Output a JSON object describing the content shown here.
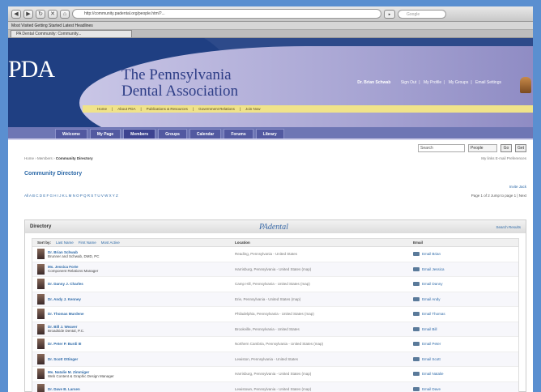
{
  "browser": {
    "url": "http://community.padental.org/people.html?...",
    "search_placeholder": "Google",
    "bookmarks": "Most Visited   Getting Started   Latest Headlines",
    "tab_title": "PA Dental Community: Community..."
  },
  "header": {
    "logo": "PDA",
    "title_line1": "The Pennsylvania",
    "title_line2": "Dental Association",
    "user_name": "Dr. Brian Schwab",
    "links": [
      "Sign Out",
      "My Profile",
      "My Groups",
      "Email Settings"
    ],
    "sub_nav": [
      "Home",
      "About PDA",
      "Publications & Resources",
      "Government Relations",
      "Join Now"
    ]
  },
  "main_nav": [
    "Welcome",
    "My Page",
    "Members",
    "Groups",
    "Calendar",
    "Forums",
    "Library"
  ],
  "search": {
    "value": "Search",
    "scope": "People",
    "go_label": "Go",
    "go2_label": "Get"
  },
  "breadcrumb": {
    "home": "Home",
    "sep1": "›",
    "members": "Members",
    "sep2": "›",
    "current": "Community Directory",
    "right_info": "My links   E-mail Preferences"
  },
  "page_title": "Community Directory",
  "invite_link": "Invite Jack",
  "alphabet": "All  A  B  C  D  E  F  G  H  I  J  K  L  M  N  O  P  Q  R  S  T  U  V  W  X  Y  Z",
  "pagination": "Page 1 of 2   Jump to page 1   |  Next",
  "directory": {
    "title": "Directory",
    "mark": "PAdental",
    "search_results": "Search Results",
    "sort_by_label": "Sort by:",
    "sort_options": [
      "Last Name",
      "First Name",
      "Most Active"
    ],
    "col_location": "Location",
    "col_email": "Email",
    "rows": [
      {
        "name": "Dr. Brian Schwab",
        "sub": "Brunner and Schwab, DMD, PC",
        "location": "Reading, Pennsylvania - United States",
        "email": "Email Brian"
      },
      {
        "name": "Ms. Jessica Forte",
        "sub": "Component Relations Manager",
        "location": "Harrisburg, Pennsylvania - United States (map)",
        "email": "Email Jessica"
      },
      {
        "name": "Dr. Danny J. Charles",
        "sub": "",
        "location": "Camp Hill, Pennsylvania - United States (map)",
        "email": "Email Danny"
      },
      {
        "name": "Dr. Andy J. Kenney",
        "sub": "",
        "location": "Erie, Pennsylvania - United States (map)",
        "email": "Email Andy"
      },
      {
        "name": "Dr. Thomas Murdene",
        "sub": "",
        "location": "Philadelphia, Pennsylvania - United States (map)",
        "email": "Email Thomas"
      },
      {
        "name": "Dr. Bill J. Weaver",
        "sub": "Broadside Dental, P.C.",
        "location": "Brookville, Pennsylvania - United States",
        "email": "Email Bill"
      },
      {
        "name": "Dr. Peter P. Burdi III",
        "sub": "",
        "location": "Northern Cambria, Pennsylvania - United States (map)",
        "email": "Email Peter"
      },
      {
        "name": "Dr. Scott Ottinger",
        "sub": "",
        "location": "Lewiston, Pennsylvania - United States",
        "email": "Email Scott"
      },
      {
        "name": "Ms. Natalie M. Zimmiger",
        "sub": "Web Content & Graphic Design Manager",
        "location": "Harrisburg, Pennsylvania - United States (map)",
        "email": "Email Natalie"
      },
      {
        "name": "Dr. Dave B. Larsen",
        "sub": "",
        "location": "Lewistown, Pennsylvania - United States (map)",
        "email": "Email Dave"
      }
    ]
  }
}
